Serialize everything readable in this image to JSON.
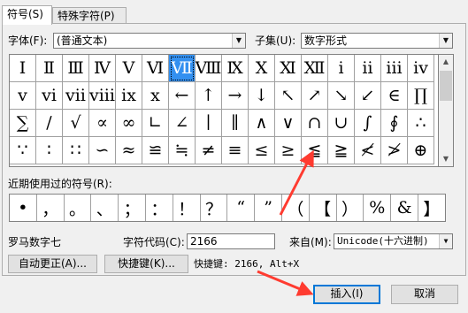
{
  "tabs": [
    {
      "label": "符号(S)",
      "active": true
    },
    {
      "label": "特殊字符(P)",
      "active": false
    }
  ],
  "font": {
    "label": "字体(F):",
    "value": "(普通文本)"
  },
  "subset": {
    "label": "子集(U):",
    "value": "数字形式"
  },
  "symbols": [
    "Ⅰ",
    "Ⅱ",
    "Ⅲ",
    "Ⅳ",
    "Ⅴ",
    "Ⅵ",
    "Ⅶ",
    "Ⅷ",
    "Ⅸ",
    "Ⅹ",
    "Ⅺ",
    "Ⅻ",
    "ⅰ",
    "ⅱ",
    "ⅲ",
    "ⅳ",
    "ⅴ",
    "ⅵ",
    "ⅶ",
    "ⅷ",
    "ⅸ",
    "ⅹ",
    "←",
    "↑",
    "→",
    "↓",
    "↖",
    "↗",
    "↘",
    "↙",
    "∈",
    "∏",
    "∑",
    "∕",
    "√",
    "∝",
    "∞",
    "∟",
    "∠",
    "∣",
    "∥",
    "∧",
    "∨",
    "∩",
    "∪",
    "∫",
    "∮",
    "∴",
    "∵",
    "∶",
    "∷",
    "∽",
    "≈",
    "≌",
    "≒",
    "≠",
    "≡",
    "≤",
    "≥",
    "≦",
    "≧",
    "≮",
    "≯",
    "⊕"
  ],
  "selected_symbol_index": 6,
  "recent": {
    "label": "近期使用过的符号(R):",
    "symbols": [
      "•",
      "，",
      "。",
      "、",
      "；",
      "：",
      "！",
      "？",
      "“",
      "”",
      "（",
      "【",
      "）",
      "%",
      "&",
      "】"
    ]
  },
  "char_name": "罗马数字七",
  "char_code": {
    "label": "字符代码(C):",
    "value": "2166"
  },
  "from": {
    "label": "来自(M):",
    "value": "Unicode(十六进制)"
  },
  "autocorrect_button": "自动更正(A)...",
  "shortcut_button": "快捷键(K)...",
  "shortcut_text": "快捷键: 2166, Alt+X",
  "insert_button": "插入(I)",
  "cancel_button": "取消",
  "colors": {
    "selection": "#3390f0",
    "arrow": "#ff3b30",
    "default_button_border": "#0078d7"
  },
  "icons": {
    "dropdown": "chevron-down-icon",
    "scroll_up": "arrow-up-icon",
    "scroll_down": "arrow-down-icon"
  }
}
